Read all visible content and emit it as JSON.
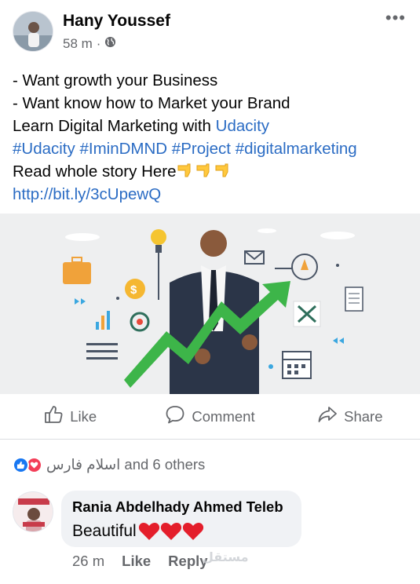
{
  "post": {
    "author": "Hany Youssef",
    "time": "58 m",
    "separator": "·",
    "privacy_icon": "globe-icon",
    "more_icon": "more-icon",
    "text": {
      "line1": "- Want growth your Business",
      "line2": "- Want know how to Market your Brand",
      "line3_prefix": "Learn Digital Marketing with ",
      "line3_link": "Udacity",
      "hashtags": [
        "#Udacity",
        "#IminDMND",
        "#Project",
        "#digitalmarketing"
      ],
      "line5": "Read whole story Here",
      "url": "http://bit.ly/3cUpewQ"
    }
  },
  "actions": {
    "like": "Like",
    "comment": "Comment",
    "share": "Share"
  },
  "reactions": {
    "names": "اسلام فارس and 6 others"
  },
  "comment": {
    "author": "Rania Abdelhady Ahmed Teleb",
    "text": "Beautiful",
    "time": "26 m",
    "like": "Like",
    "reply": "Reply"
  },
  "watermark": "مستقل",
  "colors": {
    "link": "#2b6cc4",
    "muted": "#65676b",
    "like_blue": "#1877f2",
    "love_red": "#f33e58",
    "chart_green": "#3db549",
    "bubble_bg": "#f0f2f5"
  }
}
